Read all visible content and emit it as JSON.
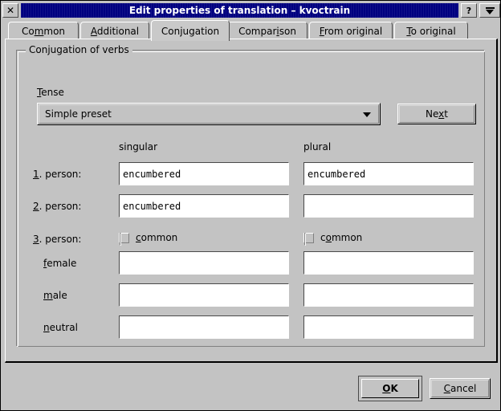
{
  "window": {
    "title": "Edit properties of translation – kvoctrain",
    "close_label": "✕",
    "help_label": "?",
    "shade_label": "shade"
  },
  "tabs": [
    {
      "label_pre": "Co",
      "accel": "m",
      "label_post": "mon",
      "name": "common",
      "active": false
    },
    {
      "label_pre": "",
      "accel": "A",
      "label_post": "dditional",
      "name": "additional",
      "active": false
    },
    {
      "label_pre": "Conjugation",
      "accel": "",
      "label_post": "",
      "name": "conjugation",
      "active": true
    },
    {
      "label_pre": "Compar",
      "accel": "i",
      "label_post": "son",
      "name": "comparison",
      "active": false
    },
    {
      "label_pre": "",
      "accel": "F",
      "label_post": "rom original",
      "name": "from-original",
      "active": false
    },
    {
      "label_pre": "",
      "accel": "T",
      "label_post": "o original",
      "name": "to-original",
      "active": false
    }
  ],
  "group": {
    "title": "Conjugation of verbs"
  },
  "tense": {
    "label_pre": "",
    "label_accel": "T",
    "label_post": "ense",
    "value": "Simple preset",
    "arrow": "chevron-down",
    "next_pre": "Ne",
    "next_accel": "x",
    "next_post": "t"
  },
  "columns": {
    "singular": "singular",
    "plural": "plural"
  },
  "rows": [
    {
      "name": "first-person",
      "label_accel": "1",
      "label_post": ". person:",
      "singular": "encumbered",
      "plural": "encumbered"
    },
    {
      "name": "second-person",
      "label_accel": "2",
      "label_post": ". person:",
      "singular": "encumbered",
      "plural": ""
    },
    {
      "name": "third-person",
      "label_accel": "3",
      "label_post": ". person:",
      "singular": "",
      "plural": ""
    }
  ],
  "common": {
    "singular": {
      "pre": "",
      "accel": "c",
      "post": "ommon",
      "checked": false
    },
    "plural": {
      "pre": "c",
      "accel": "o",
      "post": "mmon",
      "checked": false
    }
  },
  "genders": [
    {
      "name": "female",
      "pre": "",
      "accel": "f",
      "post": "emale",
      "singular": "",
      "plural": ""
    },
    {
      "name": "male",
      "pre": "",
      "accel": "m",
      "post": "ale",
      "singular": "",
      "plural": ""
    },
    {
      "name": "neutral",
      "pre": "",
      "accel": "n",
      "post": "eutral",
      "singular": "",
      "plural": ""
    }
  ],
  "footer": {
    "ok_pre": "",
    "ok_accel": "O",
    "ok_post": "K",
    "cancel_pre": "",
    "cancel_accel": "C",
    "cancel_post": "ancel"
  },
  "colors": {
    "titlebar": "#000080",
    "titlebar_text": "#ffffff",
    "face": "#c3c3c3",
    "field": "#ffffff",
    "text": "#000000",
    "shadow": "#808080",
    "light": "#ffffff"
  }
}
